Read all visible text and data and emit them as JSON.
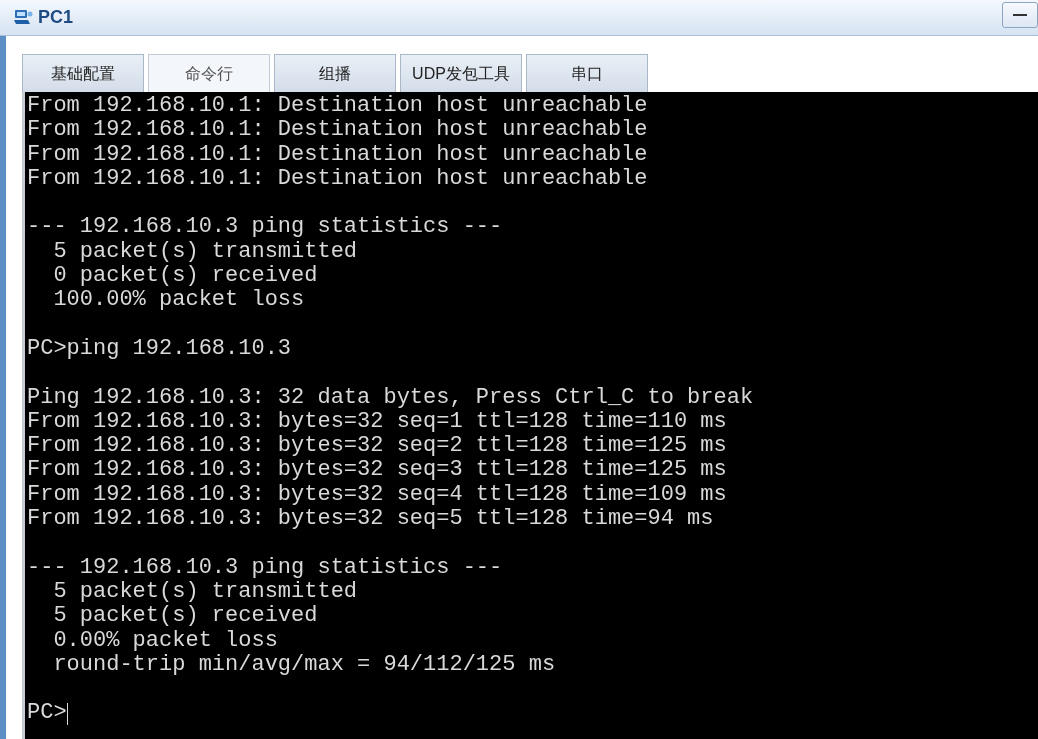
{
  "window": {
    "title": "PC1"
  },
  "tabs": [
    {
      "label": "基础配置",
      "selected": false
    },
    {
      "label": "命令行",
      "selected": true
    },
    {
      "label": "组播",
      "selected": false
    },
    {
      "label": "UDP发包工具",
      "selected": false
    },
    {
      "label": "串口",
      "selected": false
    }
  ],
  "terminal": {
    "blocks": [
      [
        "From 192.168.10.1: Destination host unreachable",
        "From 192.168.10.1: Destination host unreachable",
        "From 192.168.10.1: Destination host unreachable",
        "From 192.168.10.1: Destination host unreachable"
      ],
      [
        "--- 192.168.10.3 ping statistics ---",
        "  5 packet(s) transmitted",
        "  0 packet(s) received",
        "  100.00% packet loss"
      ],
      [
        "PC>ping 192.168.10.3"
      ],
      [
        "Ping 192.168.10.3: 32 data bytes, Press Ctrl_C to break",
        "From 192.168.10.3: bytes=32 seq=1 ttl=128 time=110 ms",
        "From 192.168.10.3: bytes=32 seq=2 ttl=128 time=125 ms",
        "From 192.168.10.3: bytes=32 seq=3 ttl=128 time=125 ms",
        "From 192.168.10.3: bytes=32 seq=4 ttl=128 time=109 ms",
        "From 192.168.10.3: bytes=32 seq=5 ttl=128 time=94 ms"
      ],
      [
        "--- 192.168.10.3 ping statistics ---",
        "  5 packet(s) transmitted",
        "  5 packet(s) received",
        "  0.00% packet loss",
        "  round-trip min/avg/max = 94/112/125 ms"
      ]
    ],
    "prompt": "PC>"
  }
}
